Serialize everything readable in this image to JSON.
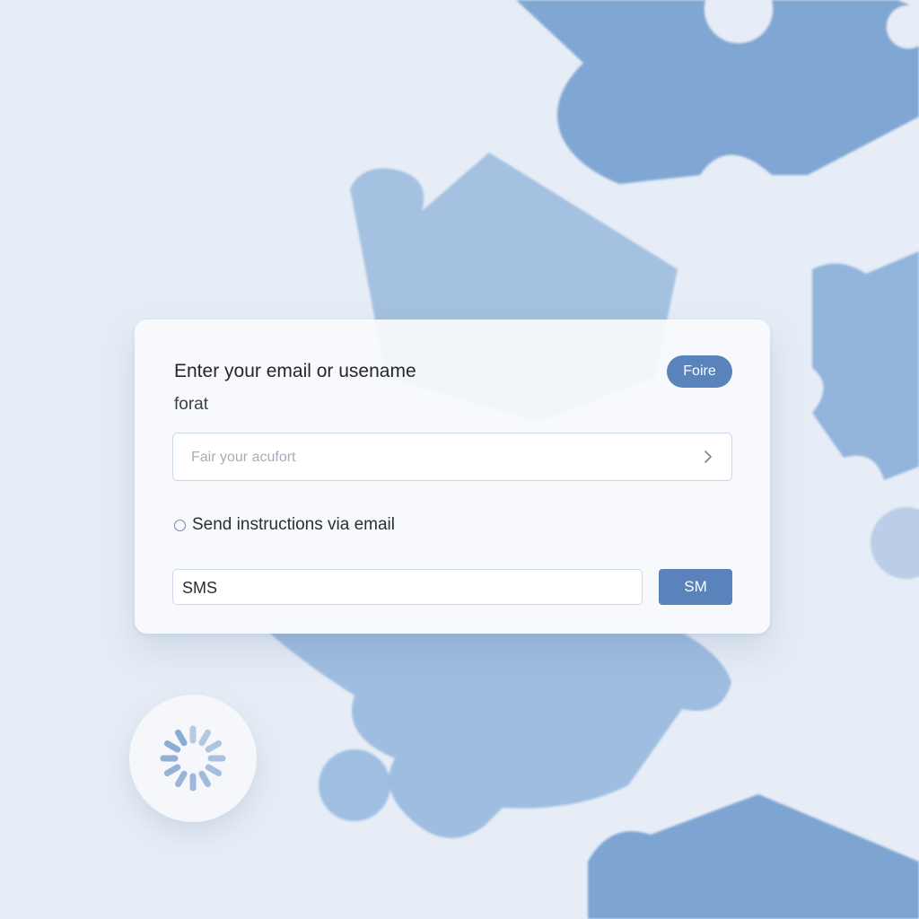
{
  "background": {
    "base_color": "#e6edf6",
    "puzzle_color": "#5a8bc8",
    "icon": "puzzle-pieces"
  },
  "dialog": {
    "title": "Enter your email or usename",
    "subtitle": "forat",
    "pill_button_label": "Foire",
    "input": {
      "placeholder": "Fair your acufort",
      "value": ""
    },
    "option": {
      "label": "Send instructions via email",
      "selected": false
    },
    "sms_input": {
      "value": "SMS"
    },
    "sms_button_label": "SM"
  },
  "colors": {
    "accent": "#5a82bb",
    "card": "#f8fafd"
  },
  "spinner": {
    "icon": "loading-spinner-icon"
  }
}
